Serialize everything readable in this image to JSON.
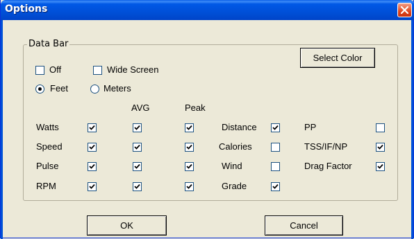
{
  "window": {
    "title": "Options"
  },
  "group": {
    "label": "Data Bar"
  },
  "buttons": {
    "select_color": "Select Color",
    "ok": "OK",
    "cancel": "Cancel"
  },
  "top_options": {
    "off": {
      "label": "Off",
      "checked": false
    },
    "wide_screen": {
      "label": "Wide Screen",
      "checked": false
    },
    "feet": {
      "label": "Feet",
      "selected": true
    },
    "meters": {
      "label": "Meters",
      "selected": false
    }
  },
  "headers": {
    "avg": "AVG",
    "peak": "Peak"
  },
  "left_rows": [
    {
      "label": "Watts",
      "main": true,
      "avg": true,
      "peak": true
    },
    {
      "label": "Speed",
      "main": true,
      "avg": true,
      "peak": true
    },
    {
      "label": "Pulse",
      "main": true,
      "avg": true,
      "peak": true
    },
    {
      "label": "RPM",
      "main": true,
      "avg": true,
      "peak": true
    }
  ],
  "middle_rows": [
    {
      "label": "Distance",
      "checked": true
    },
    {
      "label": "Calories",
      "checked": false
    },
    {
      "label": "Wind",
      "checked": false
    },
    {
      "label": "Grade",
      "checked": true
    }
  ],
  "right_rows": [
    {
      "label": "PP",
      "checked": false
    },
    {
      "label": "TSS/IF/NP",
      "checked": true
    },
    {
      "label": "Drag Factor",
      "checked": true
    }
  ]
}
